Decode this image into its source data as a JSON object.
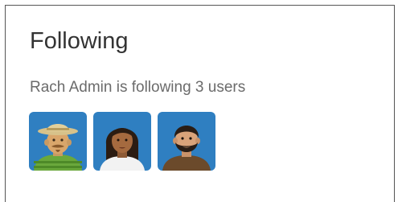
{
  "section": {
    "title": "Following",
    "summary": "Rach Admin is following 3 users"
  },
  "avatars": [
    {
      "icon": "user-avatar-hat-icon"
    },
    {
      "icon": "user-avatar-woman-icon"
    },
    {
      "icon": "user-avatar-beard-icon"
    }
  ],
  "colors": {
    "avatar_background": "#2f7fc1",
    "title_text": "#333333",
    "summary_text": "#6b6b6b"
  }
}
